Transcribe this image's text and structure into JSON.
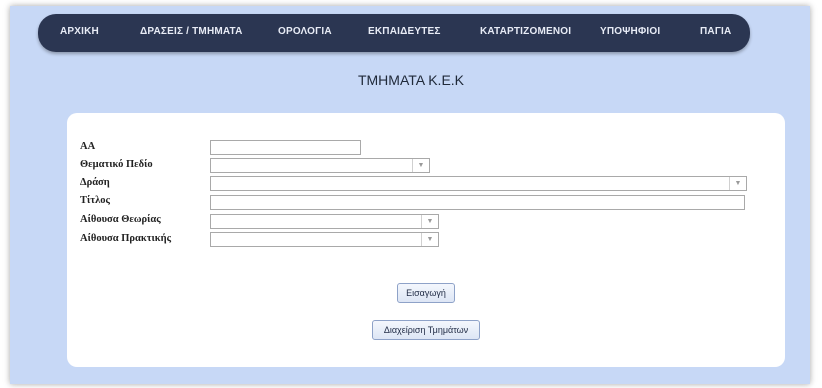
{
  "nav": {
    "items": [
      {
        "label": "ΑΡΧΙΚΗ"
      },
      {
        "label": "ΔΡΑΣΕΙΣ / ΤΜΗΜΑΤΑ"
      },
      {
        "label": "ΟΡΟΛΟΓΙΑ"
      },
      {
        "label": "ΕΚΠΑΙΔΕΥΤΕΣ"
      },
      {
        "label": "ΚΑΤΑΡΤΙΖΟΜΕΝΟΙ"
      },
      {
        "label": "ΥΠΟΨΗΦΙΟΙ"
      },
      {
        "label": "ΠΑΓΙΑ"
      }
    ]
  },
  "page": {
    "title": "ΤΜΗΜΑΤΑ Κ.Ε.Κ"
  },
  "form": {
    "aa": {
      "label": "ΑΑ",
      "value": ""
    },
    "thematic_field": {
      "label": "Θεματικό Πεδίο",
      "value": ""
    },
    "action": {
      "label": "Δράση",
      "value": ""
    },
    "title": {
      "label": "Τίτλος",
      "value": ""
    },
    "theory_room": {
      "label": "Αίθουσα Θεωρίας",
      "value": ""
    },
    "practice_room": {
      "label": "Αίθουσα Πρακτικής",
      "value": ""
    }
  },
  "buttons": {
    "insert": "Εισαγωγή",
    "manage": "Διαχείριση Τμημάτων"
  },
  "colors": {
    "background": "#c7d8f6",
    "navbar": "#2b3652",
    "panel": "#ffffff"
  }
}
